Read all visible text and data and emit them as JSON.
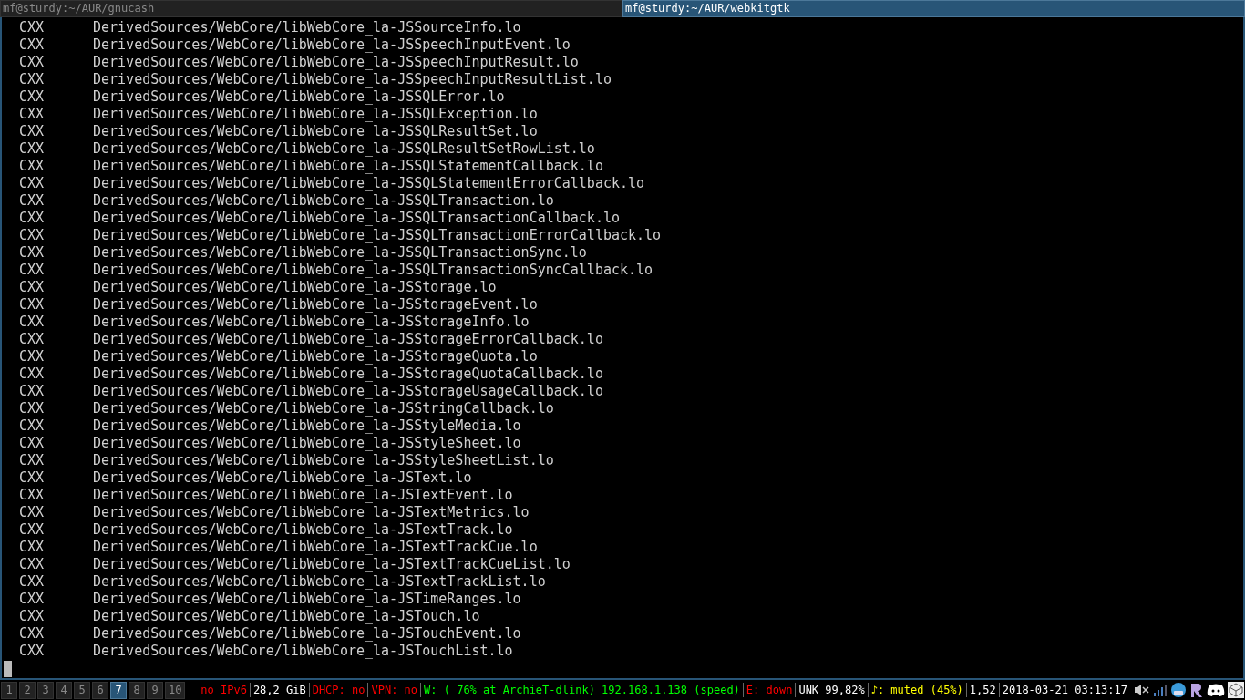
{
  "tabs": [
    {
      "title": "mf@sturdy:~/AUR/gnucash",
      "selected": false
    },
    {
      "title": "mf@sturdy:~/AUR/webkitgtk",
      "selected": true
    }
  ],
  "terminal": {
    "lines": [
      {
        "op": "CXX",
        "file": "DerivedSources/WebCore/libWebCore_la-JSSourceInfo.lo"
      },
      {
        "op": "CXX",
        "file": "DerivedSources/WebCore/libWebCore_la-JSSpeechInputEvent.lo"
      },
      {
        "op": "CXX",
        "file": "DerivedSources/WebCore/libWebCore_la-JSSpeechInputResult.lo"
      },
      {
        "op": "CXX",
        "file": "DerivedSources/WebCore/libWebCore_la-JSSpeechInputResultList.lo"
      },
      {
        "op": "CXX",
        "file": "DerivedSources/WebCore/libWebCore_la-JSSQLError.lo"
      },
      {
        "op": "CXX",
        "file": "DerivedSources/WebCore/libWebCore_la-JSSQLException.lo"
      },
      {
        "op": "CXX",
        "file": "DerivedSources/WebCore/libWebCore_la-JSSQLResultSet.lo"
      },
      {
        "op": "CXX",
        "file": "DerivedSources/WebCore/libWebCore_la-JSSQLResultSetRowList.lo"
      },
      {
        "op": "CXX",
        "file": "DerivedSources/WebCore/libWebCore_la-JSSQLStatementCallback.lo"
      },
      {
        "op": "CXX",
        "file": "DerivedSources/WebCore/libWebCore_la-JSSQLStatementErrorCallback.lo"
      },
      {
        "op": "CXX",
        "file": "DerivedSources/WebCore/libWebCore_la-JSSQLTransaction.lo"
      },
      {
        "op": "CXX",
        "file": "DerivedSources/WebCore/libWebCore_la-JSSQLTransactionCallback.lo"
      },
      {
        "op": "CXX",
        "file": "DerivedSources/WebCore/libWebCore_la-JSSQLTransactionErrorCallback.lo"
      },
      {
        "op": "CXX",
        "file": "DerivedSources/WebCore/libWebCore_la-JSSQLTransactionSync.lo"
      },
      {
        "op": "CXX",
        "file": "DerivedSources/WebCore/libWebCore_la-JSSQLTransactionSyncCallback.lo"
      },
      {
        "op": "CXX",
        "file": "DerivedSources/WebCore/libWebCore_la-JSStorage.lo"
      },
      {
        "op": "CXX",
        "file": "DerivedSources/WebCore/libWebCore_la-JSStorageEvent.lo"
      },
      {
        "op": "CXX",
        "file": "DerivedSources/WebCore/libWebCore_la-JSStorageInfo.lo"
      },
      {
        "op": "CXX",
        "file": "DerivedSources/WebCore/libWebCore_la-JSStorageErrorCallback.lo"
      },
      {
        "op": "CXX",
        "file": "DerivedSources/WebCore/libWebCore_la-JSStorageQuota.lo"
      },
      {
        "op": "CXX",
        "file": "DerivedSources/WebCore/libWebCore_la-JSStorageQuotaCallback.lo"
      },
      {
        "op": "CXX",
        "file": "DerivedSources/WebCore/libWebCore_la-JSStorageUsageCallback.lo"
      },
      {
        "op": "CXX",
        "file": "DerivedSources/WebCore/libWebCore_la-JSStringCallback.lo"
      },
      {
        "op": "CXX",
        "file": "DerivedSources/WebCore/libWebCore_la-JSStyleMedia.lo"
      },
      {
        "op": "CXX",
        "file": "DerivedSources/WebCore/libWebCore_la-JSStyleSheet.lo"
      },
      {
        "op": "CXX",
        "file": "DerivedSources/WebCore/libWebCore_la-JSStyleSheetList.lo"
      },
      {
        "op": "CXX",
        "file": "DerivedSources/WebCore/libWebCore_la-JSText.lo"
      },
      {
        "op": "CXX",
        "file": "DerivedSources/WebCore/libWebCore_la-JSTextEvent.lo"
      },
      {
        "op": "CXX",
        "file": "DerivedSources/WebCore/libWebCore_la-JSTextMetrics.lo"
      },
      {
        "op": "CXX",
        "file": "DerivedSources/WebCore/libWebCore_la-JSTextTrack.lo"
      },
      {
        "op": "CXX",
        "file": "DerivedSources/WebCore/libWebCore_la-JSTextTrackCue.lo"
      },
      {
        "op": "CXX",
        "file": "DerivedSources/WebCore/libWebCore_la-JSTextTrackCueList.lo"
      },
      {
        "op": "CXX",
        "file": "DerivedSources/WebCore/libWebCore_la-JSTextTrackList.lo"
      },
      {
        "op": "CXX",
        "file": "DerivedSources/WebCore/libWebCore_la-JSTimeRanges.lo"
      },
      {
        "op": "CXX",
        "file": "DerivedSources/WebCore/libWebCore_la-JSTouch.lo"
      },
      {
        "op": "CXX",
        "file": "DerivedSources/WebCore/libWebCore_la-JSTouchEvent.lo"
      },
      {
        "op": "CXX",
        "file": "DerivedSources/WebCore/libWebCore_la-JSTouchList.lo"
      }
    ]
  },
  "workspaces": [
    {
      "label": "1",
      "selected": false
    },
    {
      "label": "2",
      "selected": false
    },
    {
      "label": "3",
      "selected": false
    },
    {
      "label": "4",
      "selected": false
    },
    {
      "label": "5",
      "selected": false
    },
    {
      "label": "6",
      "selected": false
    },
    {
      "label": "7",
      "selected": true
    },
    {
      "label": "8",
      "selected": false
    },
    {
      "label": "9",
      "selected": false
    },
    {
      "label": "10",
      "selected": false
    }
  ],
  "status": [
    {
      "text": "no IPv6",
      "color": "#ff0000"
    },
    {
      "text": "28,2 GiB",
      "color": "#ffffff"
    },
    {
      "text": "DHCP: no",
      "color": "#ff0000"
    },
    {
      "text": "VPN: no",
      "color": "#ff0000"
    },
    {
      "text": "W: ( 76% at ArchieT-dlink) 192.168.1.138 (speed)",
      "color": "#00ff00"
    },
    {
      "text": "E: down",
      "color": "#ff0000"
    },
    {
      "text": "UNK 99,82%",
      "color": "#ffffff"
    },
    {
      "text": "♪: muted (45%)",
      "color": "#ffff00"
    },
    {
      "text": "1,52",
      "color": "#ffffff"
    },
    {
      "text": "2018-03-21 03:13:17",
      "color": "#ffffff"
    }
  ]
}
